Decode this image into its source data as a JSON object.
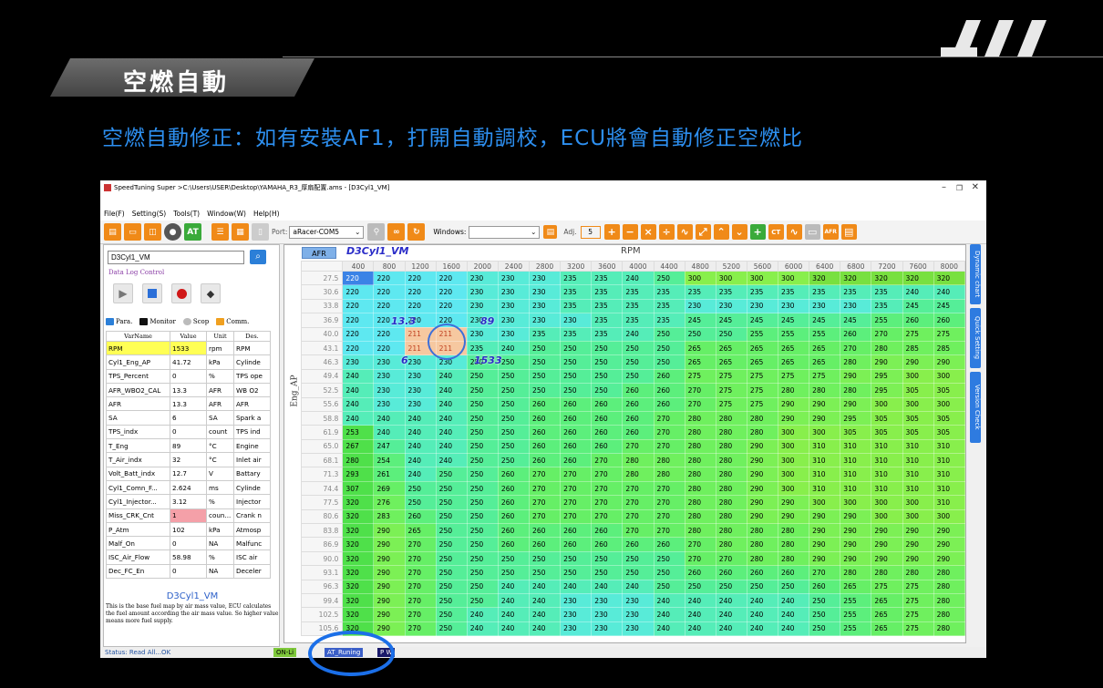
{
  "slide": {
    "title": "空燃自動",
    "subtitle": "空燃自動修正：如有安裝AF1，打開自動調校，ECU將會自動修正空燃比"
  },
  "window": {
    "title": "SpeedTuning Super >C:\\Users\\USER\\Desktop\\YAMAHA_R3_厚扇配置.ams - [D3Cyl1_VM]"
  },
  "menu": [
    "File(F)",
    "Setting(S)",
    "Tools(T)",
    "Window(W)",
    "Help(H)"
  ],
  "toolbar": {
    "port_label": "Port:",
    "port_value": "aRacer-COM5",
    "windows_label": "Windows:",
    "adj_label": "Adj.",
    "adj_value": "5"
  },
  "left": {
    "search_value": "D3Cyl1_VM",
    "data_log_label": "Data Log Control",
    "tabs": [
      "Para.",
      "Monitor",
      "Scop",
      "Comm."
    ],
    "monitor_headers": [
      "VarName",
      "Value",
      "Unit",
      "Des."
    ],
    "monitor_rows": [
      [
        "RPM",
        "1533",
        "rpm",
        "RPM"
      ],
      [
        "Cyl1_Eng_AP",
        "41.72",
        "kPa",
        "Cylinde"
      ],
      [
        "TPS_Percent",
        "0",
        "%",
        "TPS ope"
      ],
      [
        "AFR_WBO2_CAL",
        "13.3",
        "AFR",
        "WB O2"
      ],
      [
        "AFR",
        "13.3",
        "AFR",
        "AFR"
      ],
      [
        "SA",
        "6",
        "SA",
        "Spark a"
      ],
      [
        "TPS_indx",
        "0",
        "count",
        "TPS ind"
      ],
      [
        "T_Eng",
        "89",
        "°C",
        "Engine"
      ],
      [
        "T_Air_indx",
        "32",
        "°C",
        "Inlet air"
      ],
      [
        "Volt_Batt_indx",
        "12.7",
        "V",
        "Battary"
      ],
      [
        "Cyl1_Comn_F...",
        "2.624",
        "ms",
        "Cylinde"
      ],
      [
        "Cyl1_Injector...",
        "3.12",
        "%",
        "Injector"
      ],
      [
        "Miss_CRK_Cnt",
        "1",
        "coun...",
        "Crank n"
      ],
      [
        "P_Atm",
        "102",
        "kPa",
        "Atmosp"
      ],
      [
        "Malf_On",
        "0",
        "NA",
        "Malfunc"
      ],
      [
        "ISC_Air_Flow",
        "58.98",
        "%",
        "ISC air"
      ],
      [
        "Dec_FC_En",
        "0",
        "NA",
        "Deceler"
      ]
    ],
    "map_name": "D3Cyl1_VM",
    "description": "This is the base fuel map by air mass value, ECU calculates the fuel amount according the air mass value. So higher value means more fuel supply."
  },
  "map": {
    "afr_label": "AFR",
    "name": "D3Cyl1_VM",
    "x_title": "RPM",
    "y_title": "Eng_AP",
    "overlay_afr": "13.3",
    "overlay_tps": "89",
    "overlay_sa": "6",
    "overlay_rpm": "1533",
    "rpm": [
      "400",
      "800",
      "1200",
      "1600",
      "2000",
      "2400",
      "2800",
      "3200",
      "3600",
      "4000",
      "4400",
      "4800",
      "5200",
      "5600",
      "6000",
      "6400",
      "6800",
      "7200",
      "7600",
      "8000"
    ],
    "ap": [
      "27.5",
      "30.6",
      "33.8",
      "36.9",
      "40.0",
      "43.1",
      "46.3",
      "49.4",
      "52.5",
      "55.6",
      "58.8",
      "61.9",
      "65.0",
      "68.1",
      "71.3",
      "74.4",
      "77.5",
      "80.6",
      "83.8",
      "86.9",
      "90.0",
      "93.1",
      "96.3",
      "99.4",
      "102.5",
      "105.6"
    ],
    "values": [
      [
        220,
        220,
        220,
        220,
        230,
        230,
        230,
        235,
        235,
        240,
        250,
        300,
        300,
        300,
        300,
        320,
        320,
        320,
        320,
        320
      ],
      [
        220,
        220,
        220,
        220,
        230,
        230,
        230,
        235,
        235,
        235,
        235,
        235,
        235,
        235,
        235,
        235,
        235,
        235,
        240,
        240
      ],
      [
        220,
        220,
        220,
        220,
        230,
        230,
        230,
        235,
        235,
        235,
        235,
        230,
        230,
        230,
        230,
        230,
        230,
        235,
        245,
        245
      ],
      [
        220,
        220,
        220,
        220,
        230,
        230,
        230,
        230,
        235,
        235,
        235,
        245,
        245,
        245,
        245,
        245,
        245,
        255,
        260,
        260
      ],
      [
        220,
        220,
        211,
        211,
        230,
        230,
        235,
        235,
        235,
        240,
        250,
        250,
        250,
        255,
        255,
        255,
        260,
        270,
        275,
        275
      ],
      [
        220,
        220,
        211,
        211,
        235,
        240,
        250,
        250,
        250,
        250,
        250,
        265,
        265,
        265,
        265,
        265,
        270,
        280,
        285,
        285
      ],
      [
        230,
        230,
        230,
        230,
        250,
        250,
        250,
        250,
        250,
        250,
        250,
        265,
        265,
        265,
        265,
        265,
        280,
        290,
        290,
        290
      ],
      [
        240,
        230,
        230,
        240,
        250,
        250,
        250,
        250,
        250,
        250,
        260,
        275,
        275,
        275,
        275,
        275,
        290,
        295,
        300,
        300
      ],
      [
        240,
        230,
        230,
        240,
        250,
        250,
        250,
        250,
        250,
        260,
        260,
        270,
        275,
        275,
        280,
        280,
        280,
        295,
        305,
        305
      ],
      [
        240,
        230,
        230,
        240,
        250,
        250,
        260,
        260,
        260,
        260,
        260,
        270,
        275,
        275,
        290,
        290,
        290,
        300,
        300,
        300
      ],
      [
        240,
        240,
        240,
        240,
        250,
        250,
        260,
        260,
        260,
        260,
        270,
        280,
        280,
        280,
        290,
        290,
        295,
        305,
        305,
        305
      ],
      [
        253,
        240,
        240,
        240,
        250,
        250,
        260,
        260,
        260,
        260,
        270,
        280,
        280,
        280,
        300,
        300,
        305,
        305,
        305,
        305
      ],
      [
        267,
        247,
        240,
        240,
        250,
        250,
        260,
        260,
        260,
        270,
        270,
        280,
        280,
        290,
        300,
        310,
        310,
        310,
        310,
        310
      ],
      [
        280,
        254,
        240,
        240,
        250,
        250,
        260,
        260,
        270,
        280,
        280,
        280,
        280,
        290,
        300,
        310,
        310,
        310,
        310,
        310
      ],
      [
        293,
        261,
        240,
        250,
        250,
        260,
        270,
        270,
        270,
        280,
        280,
        280,
        280,
        290,
        300,
        310,
        310,
        310,
        310,
        310
      ],
      [
        307,
        269,
        250,
        250,
        250,
        260,
        270,
        270,
        270,
        270,
        270,
        280,
        280,
        290,
        300,
        310,
        310,
        310,
        310,
        310
      ],
      [
        320,
        276,
        250,
        250,
        250,
        260,
        270,
        270,
        270,
        270,
        270,
        280,
        280,
        290,
        290,
        300,
        300,
        300,
        300,
        310
      ],
      [
        320,
        283,
        260,
        250,
        250,
        260,
        270,
        270,
        270,
        270,
        270,
        280,
        280,
        290,
        290,
        290,
        290,
        300,
        300,
        300
      ],
      [
        320,
        290,
        265,
        250,
        250,
        260,
        260,
        260,
        260,
        270,
        270,
        280,
        280,
        280,
        280,
        290,
        290,
        290,
        290,
        290
      ],
      [
        320,
        290,
        270,
        250,
        250,
        260,
        260,
        260,
        260,
        260,
        260,
        270,
        280,
        280,
        280,
        290,
        290,
        290,
        290,
        290
      ],
      [
        320,
        290,
        270,
        250,
        250,
        250,
        250,
        250,
        250,
        250,
        250,
        270,
        270,
        280,
        280,
        290,
        290,
        290,
        290,
        290
      ],
      [
        320,
        290,
        270,
        250,
        250,
        250,
        250,
        250,
        250,
        250,
        250,
        260,
        260,
        260,
        260,
        270,
        280,
        280,
        280,
        280
      ],
      [
        320,
        290,
        270,
        250,
        250,
        240,
        240,
        240,
        240,
        240,
        250,
        250,
        250,
        250,
        250,
        260,
        265,
        275,
        275,
        280
      ],
      [
        320,
        290,
        270,
        250,
        250,
        240,
        240,
        230,
        230,
        230,
        240,
        240,
        240,
        240,
        240,
        250,
        255,
        265,
        275,
        280
      ],
      [
        320,
        290,
        270,
        250,
        240,
        240,
        240,
        230,
        230,
        230,
        240,
        240,
        240,
        240,
        240,
        250,
        255,
        265,
        275,
        280
      ],
      [
        320,
        290,
        270,
        250,
        240,
        240,
        240,
        230,
        230,
        230,
        240,
        240,
        240,
        240,
        240,
        250,
        255,
        265,
        275,
        280
      ]
    ]
  },
  "side_tabs": [
    "Dynamic chart",
    "Quick Setting",
    "Version Check"
  ],
  "status": {
    "text": "Status: Read All...OK",
    "online": "ON-Li",
    "at": "AT_Runing",
    "pw": "P W"
  }
}
